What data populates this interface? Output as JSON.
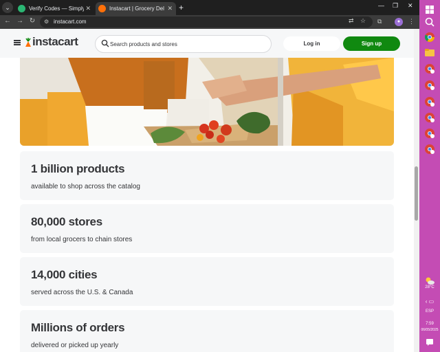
{
  "browser": {
    "tabs": [
      {
        "title": "Verify Codes — SimplyCodes"
      },
      {
        "title": "Instacart | Grocery Delivery or Pickup"
      }
    ],
    "new_tab_label": "+",
    "address": "instacart.com"
  },
  "header": {
    "logo_text": "instacart",
    "search_placeholder": "Search products and stores",
    "login_label": "Log in",
    "signup_label": "Sign up"
  },
  "stats": [
    {
      "title": "1 billion products",
      "subtitle": "available to shop across the catalog"
    },
    {
      "title": "80,000 stores",
      "subtitle": "from local grocers to chain stores"
    },
    {
      "title": "14,000 cities",
      "subtitle": "served across the U.S. & Canada"
    },
    {
      "title": "Millions of orders",
      "subtitle": "delivered or picked up yearly"
    }
  ],
  "taskbar": {
    "weather": "28°C",
    "language": "ESP",
    "time": "7:59",
    "date": "06/05/2025"
  },
  "colors": {
    "brand_green": "#108910",
    "brand_orange": "#ff7009",
    "taskbar": "#c44cb4"
  }
}
